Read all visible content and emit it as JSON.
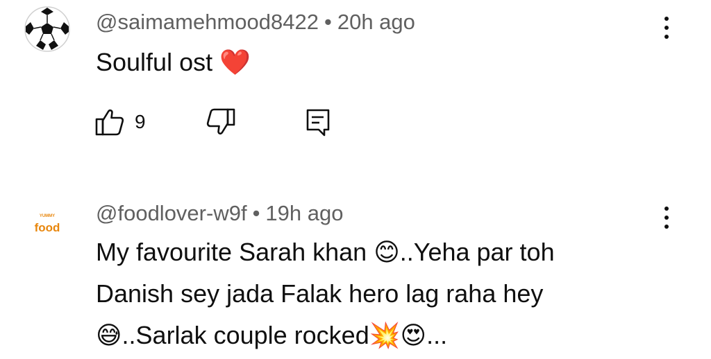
{
  "comments": [
    {
      "author": "@saimamehmood8422",
      "separator": "•",
      "time": "20h ago",
      "text_lines": [
        "Soulful ost ❤️"
      ],
      "likes": "9",
      "avatar_icon": "soccer-ball-icon"
    },
    {
      "author": "@foodlover-w9f",
      "separator": "•",
      "time": "19h ago",
      "text_lines": [
        "My favourite Sarah khan 😊..Yeha par toh",
        "Danish sey jada Falak hero lag raha hey",
        "😅..Sarlak couple rocked💥😍..."
      ],
      "avatar_icon": "food-logo-icon",
      "avatar_logo_text": "food"
    }
  ],
  "colors": {
    "meta_text": "#606060",
    "body_text": "#0f0f0f",
    "heart": "#e52d27",
    "logo_orange": "#e8860c"
  }
}
